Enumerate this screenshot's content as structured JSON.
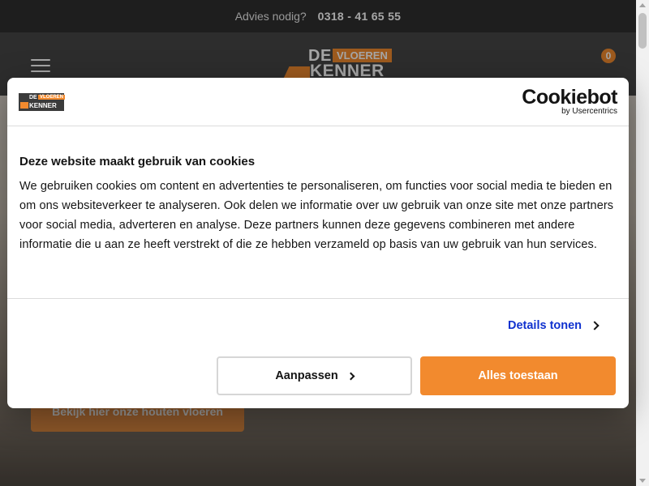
{
  "topbar": {
    "question": "Advies nodig?",
    "phone": "0318 - 41 65 55"
  },
  "header": {
    "menu_icon": "hamburger-icon",
    "logo": {
      "part1": "DE",
      "part2": "VLOEREN",
      "part3": "KENNER"
    },
    "cart_count": "0"
  },
  "hero": {
    "cta_label": "Bekijk hier onze houten vloeren"
  },
  "cookie_dialog": {
    "logo": {
      "part1": "DE",
      "part2": "VLOEREN",
      "part3": "KENNER"
    },
    "provider_name": "Cookiebot",
    "provider_sub": "by Usercentrics",
    "title": "Deze website maakt gebruik van cookies",
    "body": "We gebruiken cookies om content en advertenties te personaliseren, om functies voor social media te bieden en om ons websiteverkeer te analyseren. Ook delen we informatie over uw gebruik van onze site met onze partners voor social media, adverteren en analyse. Deze partners kunnen deze gegevens combineren met andere informatie die u aan ze heeft verstrekt of die ze hebben verzameld op basis van uw gebruik van hun services.",
    "details_label": "Details tonen",
    "customize_label": "Aanpassen",
    "allow_all_label": "Alles toestaan"
  },
  "colors": {
    "accent": "#f28a2e",
    "link": "#1032cf",
    "topbar": "#2f2f2f",
    "header": "#454545"
  }
}
